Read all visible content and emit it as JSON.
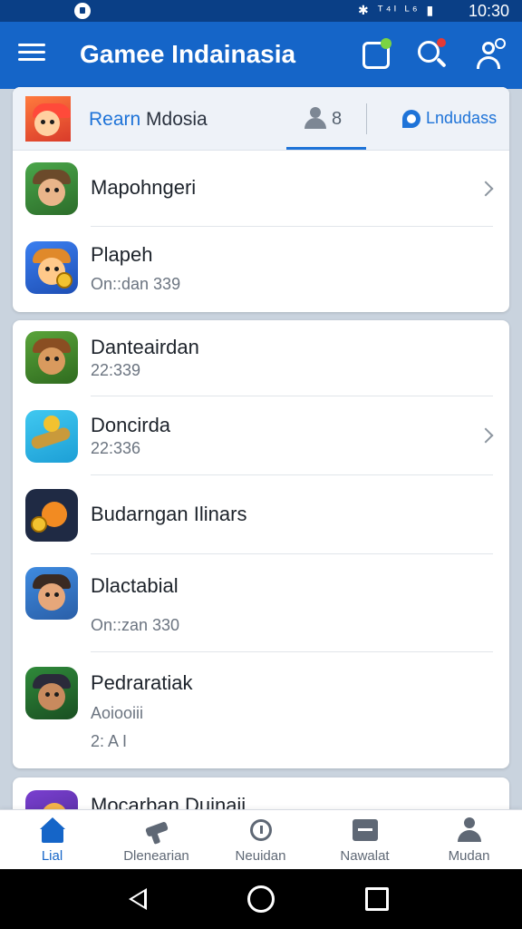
{
  "status_bar": {
    "time": "10:30",
    "signal_text": "ᵀ⁴ᴵ ᴸ⁶"
  },
  "app_bar": {
    "title": "Gamee Indainasia"
  },
  "featured_card": {
    "title_accent": "Rearn",
    "title_rest": " Mdosia",
    "people_count": "8",
    "link_label": "Lndudass",
    "rows": [
      {
        "name": "Mapohngeri",
        "sub": "",
        "has_chevron": true
      },
      {
        "name": "Plapeh",
        "sub": "On::dan 339",
        "has_chevron": false
      }
    ]
  },
  "list_card": {
    "rows": [
      {
        "name": "Danteairdan",
        "sub": "22:339",
        "sub2": ""
      },
      {
        "name": "Doncirda",
        "sub": "22:336",
        "sub2": ""
      },
      {
        "name": "Budarngan Ilinars",
        "sub": "",
        "sub2": ""
      },
      {
        "name": "Dlactabial",
        "sub": "On::zan 330",
        "sub2": ""
      },
      {
        "name": "Pedraratiak",
        "sub": "Aoiooiii",
        "sub2": "2: A I"
      }
    ]
  },
  "peek_card": {
    "name": "Mocarban Duinaii",
    "sub": ""
  },
  "bottom_nav": {
    "items": [
      {
        "label": "Lial",
        "icon": "home-icon",
        "active": true
      },
      {
        "label": "Dlenearian",
        "icon": "gun-icon",
        "active": false
      },
      {
        "label": "Neuidan",
        "icon": "clock-icon",
        "active": false
      },
      {
        "label": "Nawalat",
        "icon": "message-icon",
        "active": false
      },
      {
        "label": "Mudan",
        "icon": "user-icon",
        "active": false
      }
    ]
  },
  "colors": {
    "primary": "#1565c8",
    "status_bar": "#0a3f86",
    "accent": "#1e73d8",
    "background": "#c9d3de"
  }
}
